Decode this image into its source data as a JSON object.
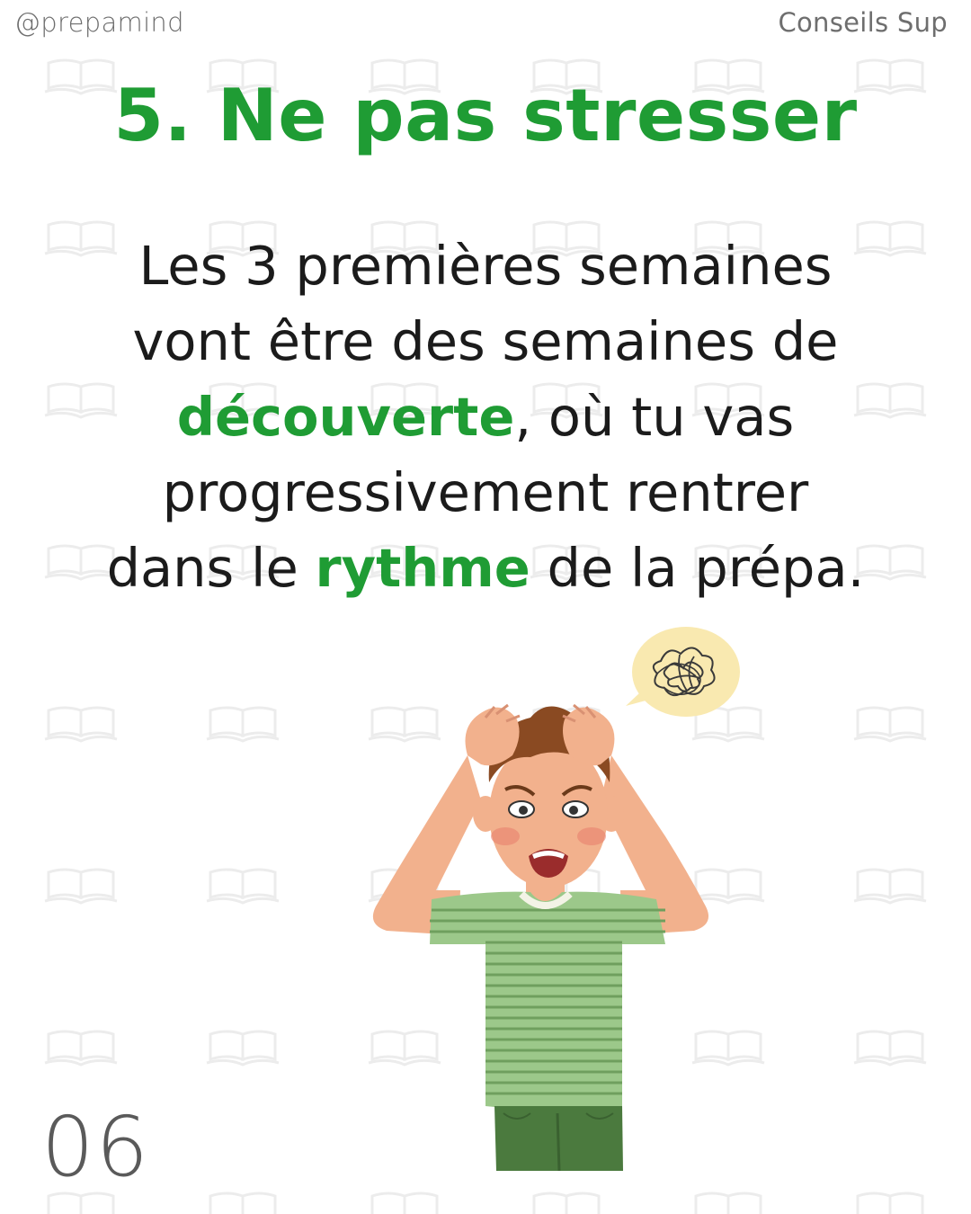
{
  "header": {
    "handle": "@prepamind",
    "series": "Conseils Sup"
  },
  "title": "5. Ne pas stresser",
  "body": {
    "line1": "Les 3 premières semaines",
    "line2": "vont être des semaines de",
    "line3_highlight": "découverte",
    "line3_rest": ", où tu vas",
    "line4": "progressivement rentrer",
    "line5_start": "dans le ",
    "line5_highlight": "rythme",
    "line5_end": " de la prépa."
  },
  "page_number": "06",
  "colors": {
    "accent": "#1f9c34",
    "text": "#1b1b1b",
    "muted": "#6e6e6e",
    "watermark": "#ececec"
  },
  "icons": {
    "background": "open-book-icon",
    "illustration": "stressed-student",
    "thought": "scribble-thought-bubble"
  }
}
